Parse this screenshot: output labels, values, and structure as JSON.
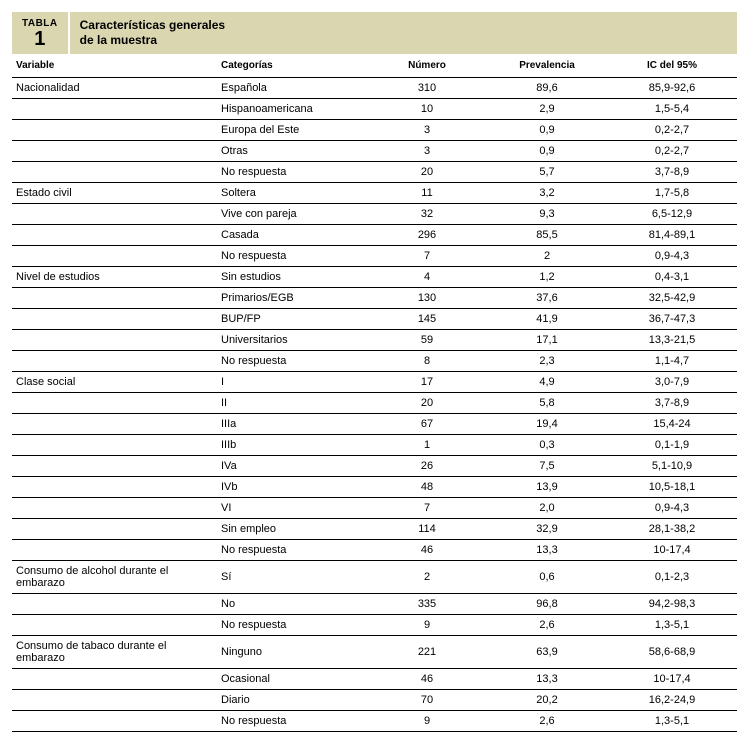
{
  "header": {
    "tabla_label": "TABLA",
    "tabla_num": "1",
    "title_line1": "Características generales",
    "title_line2": "de la muestra"
  },
  "columns": {
    "variable": "Variable",
    "categorias": "Categorías",
    "numero": "Número",
    "prevalencia": "Prevalencia",
    "ic": "IC del 95%"
  },
  "chart_data": {
    "type": "table",
    "rows": [
      {
        "variable": "Nacionalidad",
        "categoria": "Española",
        "numero": "310",
        "prevalencia": "89,6",
        "ic": "85,9-92,6"
      },
      {
        "variable": "",
        "categoria": "Hispanoamericana",
        "numero": "10",
        "prevalencia": "2,9",
        "ic": "1,5-5,4"
      },
      {
        "variable": "",
        "categoria": "Europa del Este",
        "numero": "3",
        "prevalencia": "0,9",
        "ic": "0,2-2,7"
      },
      {
        "variable": "",
        "categoria": "Otras",
        "numero": "3",
        "prevalencia": "0,9",
        "ic": "0,2-2,7"
      },
      {
        "variable": "",
        "categoria": "No respuesta",
        "numero": "20",
        "prevalencia": "5,7",
        "ic": "3,7-8,9"
      },
      {
        "variable": "Estado civil",
        "categoria": "Soltera",
        "numero": "11",
        "prevalencia": "3,2",
        "ic": "1,7-5,8"
      },
      {
        "variable": "",
        "categoria": "Vive con pareja",
        "numero": "32",
        "prevalencia": "9,3",
        "ic": "6,5-12,9"
      },
      {
        "variable": "",
        "categoria": "Casada",
        "numero": "296",
        "prevalencia": "85,5",
        "ic": "81,4-89,1"
      },
      {
        "variable": "",
        "categoria": "No respuesta",
        "numero": "7",
        "prevalencia": "2",
        "ic": "0,9-4,3"
      },
      {
        "variable": "Nivel de estudios",
        "categoria": "Sin estudios",
        "numero": "4",
        "prevalencia": "1,2",
        "ic": "0,4-3,1"
      },
      {
        "variable": "",
        "categoria": "Primarios/EGB",
        "numero": "130",
        "prevalencia": "37,6",
        "ic": "32,5-42,9"
      },
      {
        "variable": "",
        "categoria": "BUP/FP",
        "numero": "145",
        "prevalencia": "41,9",
        "ic": "36,7-47,3"
      },
      {
        "variable": "",
        "categoria": "Universitarios",
        "numero": "59",
        "prevalencia": "17,1",
        "ic": "13,3-21,5"
      },
      {
        "variable": "",
        "categoria": "No respuesta",
        "numero": "8",
        "prevalencia": "2,3",
        "ic": "1,1-4,7"
      },
      {
        "variable": "Clase social",
        "categoria": "I",
        "numero": "17",
        "prevalencia": "4,9",
        "ic": "3,0-7,9"
      },
      {
        "variable": "",
        "categoria": "II",
        "numero": "20",
        "prevalencia": "5,8",
        "ic": "3,7-8,9"
      },
      {
        "variable": "",
        "categoria": "IIIa",
        "numero": "67",
        "prevalencia": "19,4",
        "ic": "15,4-24"
      },
      {
        "variable": "",
        "categoria": "IIIb",
        "numero": "1",
        "prevalencia": "0,3",
        "ic": "0,1-1,9"
      },
      {
        "variable": "",
        "categoria": "IVa",
        "numero": "26",
        "prevalencia": "7,5",
        "ic": "5,1-10,9"
      },
      {
        "variable": "",
        "categoria": "IVb",
        "numero": "48",
        "prevalencia": "13,9",
        "ic": "10,5-18,1"
      },
      {
        "variable": "",
        "categoria": "VI",
        "numero": "7",
        "prevalencia": "2,0",
        "ic": "0,9-4,3"
      },
      {
        "variable": "",
        "categoria": "Sin empleo",
        "numero": "114",
        "prevalencia": "32,9",
        "ic": "28,1-38,2"
      },
      {
        "variable": "",
        "categoria": "No respuesta",
        "numero": "46",
        "prevalencia": "13,3",
        "ic": "10-17,4"
      },
      {
        "variable": "Consumo de alcohol durante el embarazo",
        "categoria": "Sí",
        "numero": "2",
        "prevalencia": "0,6",
        "ic": "0,1-2,3"
      },
      {
        "variable": "",
        "categoria": "No",
        "numero": "335",
        "prevalencia": "96,8",
        "ic": "94,2-98,3"
      },
      {
        "variable": "",
        "categoria": "No respuesta",
        "numero": "9",
        "prevalencia": "2,6",
        "ic": "1,3-5,1"
      },
      {
        "variable": "Consumo de tabaco durante el embarazo",
        "categoria": "Ninguno",
        "numero": "221",
        "prevalencia": "63,9",
        "ic": "58,6-68,9"
      },
      {
        "variable": "",
        "categoria": "Ocasional",
        "numero": "46",
        "prevalencia": "13,3",
        "ic": "10-17,4"
      },
      {
        "variable": "",
        "categoria": "Diario",
        "numero": "70",
        "prevalencia": "20,2",
        "ic": "16,2-24,9"
      },
      {
        "variable": "",
        "categoria": "No respuesta",
        "numero": "9",
        "prevalencia": "2,6",
        "ic": "1,3-5,1"
      }
    ]
  }
}
